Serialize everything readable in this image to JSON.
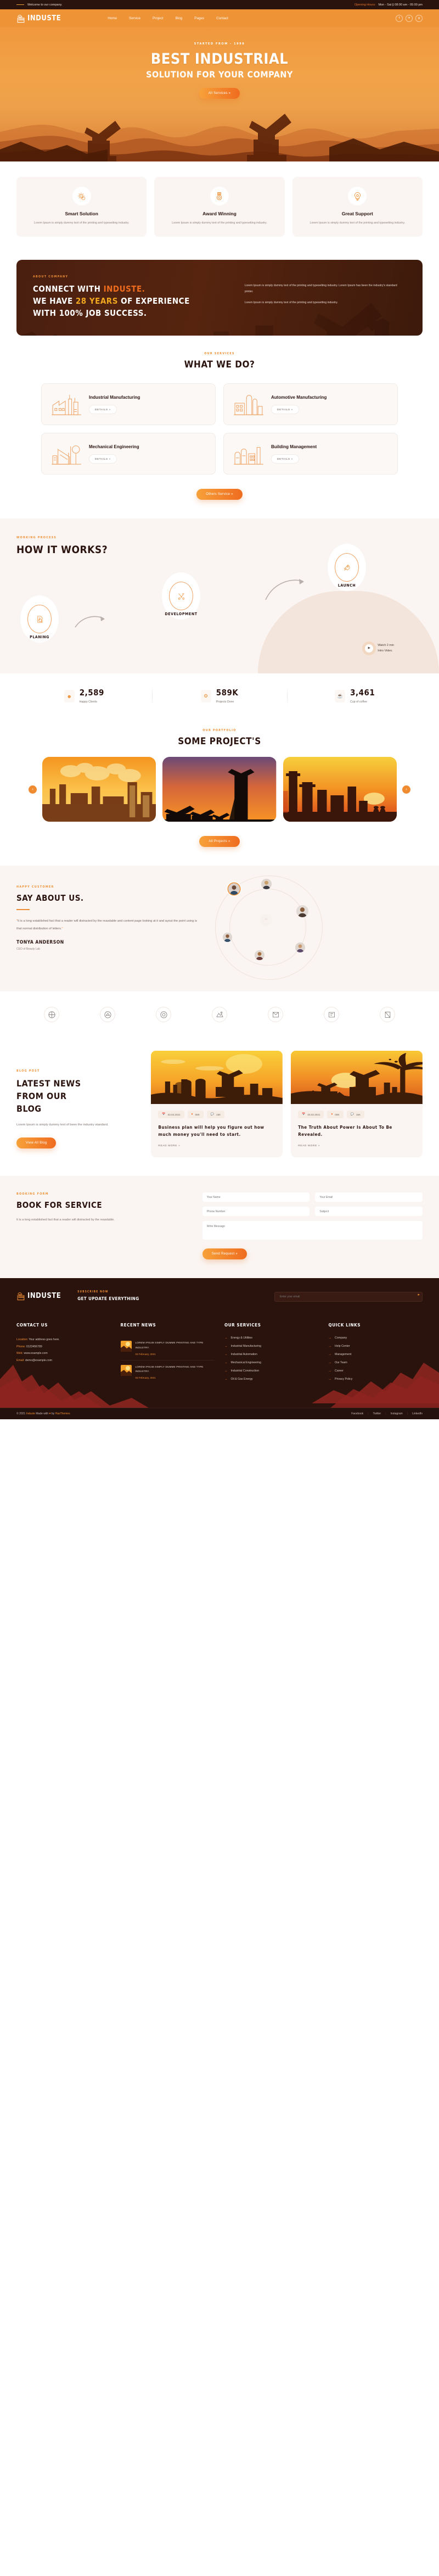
{
  "topbar": {
    "welcome": "Welcome to our company.",
    "opening_label": "Opening Hours:",
    "opening_value": "Mon - Sat || 08:00 am - 05:00 pm"
  },
  "header": {
    "brand": "INDUSTE",
    "nav": [
      {
        "label": "Home"
      },
      {
        "label": "Service"
      },
      {
        "label": "Project"
      },
      {
        "label": "Blog"
      },
      {
        "label": "Pages"
      },
      {
        "label": "Contact"
      }
    ],
    "socials": [
      {
        "name": "facebook-icon",
        "glyph": "f"
      },
      {
        "name": "twitter-icon",
        "glyph": "✈"
      },
      {
        "name": "google-icon",
        "glyph": "g"
      }
    ]
  },
  "hero": {
    "kicker": "STARTED FROM - 1998",
    "title_line1": "BEST INDUSTRIAL",
    "title_line2": "SOLUTION FOR YOUR COMPANY",
    "cta": "All Services »"
  },
  "features": [
    {
      "icon": "gear-icon",
      "title": "Smart Solution",
      "text": "Lorem Ipsum is simply dummy text of the printing and typesetting industry."
    },
    {
      "icon": "medal-icon",
      "title": "Award Winning",
      "text": "Lorem Ipsum is simply dummy text of the printing and typesetting industry."
    },
    {
      "icon": "bulb-icon",
      "title": "Great Support",
      "text": "Lorem Ipsum is simply dummy text of the printing and typesetting industry."
    }
  ],
  "about": {
    "kicker": "ABOUT COMPANY",
    "h_line1_a": "CONNECT WITH ",
    "h_line1_b": "INDUSTE.",
    "h_line2_a": "WE HAVE ",
    "h_line2_b": "28 YEARS",
    "h_line2_c": " OF EXPERIENCE",
    "h_line3": "WITH 100% JOB SUCCESS.",
    "p1": "Lorem Ipsum is simply dummy text of the printing and typesetting industry. Lorem Ipsum has been the industry's standard printer.",
    "p2": "Lorem Ipsum is simply dummy text of the printing and typesetting industry."
  },
  "services": {
    "kicker": "OUR SERVICES",
    "title": "WHAT WE DO?",
    "details_label": "DETAILS »",
    "items": [
      {
        "icon": "factory-icon",
        "title": "Industrial Manufacturing"
      },
      {
        "icon": "silo-icon",
        "title": "Automotive Manufacturing"
      },
      {
        "icon": "plant-icon",
        "title": "Mechanical Engineering"
      },
      {
        "icon": "refinery-icon",
        "title": "Building Management"
      }
    ],
    "cta": "Others Service »"
  },
  "how": {
    "kicker": "WORKING PROCESS",
    "title": "HOW IT WORKS?",
    "steps": [
      {
        "icon": "research-icon",
        "label": "PLANING"
      },
      {
        "icon": "tools-icon",
        "label": "DEVELOPMENT"
      },
      {
        "icon": "rocket-icon",
        "label": "LAUNCH"
      }
    ],
    "watch_line1": "Watch 2 min",
    "watch_line2": "Intro Video."
  },
  "counters": [
    {
      "icon": "user-icon",
      "value": "2,589",
      "label": "Happy Clients"
    },
    {
      "icon": "gear-icon",
      "value": "589K",
      "label": "Projects Done"
    },
    {
      "icon": "coffee-icon",
      "value": "3,461",
      "label": "Cup of coffee"
    }
  ],
  "portfolio": {
    "kicker": "OUR PORTFOLIO",
    "title": "SOME PROJECT'S",
    "prev": "‹",
    "next": "›",
    "cta": "All Projects »",
    "slides": [
      {
        "name": "refinery-sunset"
      },
      {
        "name": "oil-rig-dusk"
      },
      {
        "name": "plant-sunrise"
      }
    ]
  },
  "testimonial": {
    "kicker": "HAPPY CUSTOMER",
    "title": "SAY ABOUT US.",
    "quote": "It is a long established fact that a reader will distracted by the reasdable and content page looking at it and ayout the point using is that normal distribution of letters.",
    "name": "Tonya Anderson",
    "role": "CEO of Beauty Lab"
  },
  "brands": [
    {
      "name": "brand-logo-1"
    },
    {
      "name": "brand-logo-2"
    },
    {
      "name": "brand-logo-3"
    },
    {
      "name": "brand-logo-4"
    },
    {
      "name": "brand-logo-5"
    },
    {
      "name": "brand-logo-6"
    },
    {
      "name": "brand-logo-7"
    }
  ],
  "blog": {
    "kicker": "BLOG POST",
    "title_l1": "LATEST NEWS",
    "title_l2": "FROM OUR",
    "title_l3": "BLOG",
    "text": "Lorem Ipsum is simply dummy text of been the industry standard.",
    "cta": "View All Blog",
    "read_more": "READ MORE »",
    "posts": [
      {
        "date": "03.02.2021",
        "likes": "08K",
        "comments": "15K",
        "title": "Business plan will help you figure out how much money you'll need to start."
      },
      {
        "date": "03.02.2021",
        "likes": "08K",
        "comments": "15K",
        "title": "The Truth About Power Is About To Be Revealed."
      }
    ]
  },
  "booking": {
    "kicker": "BOOKING FORM",
    "title": "BOOK FOR SERVICE",
    "text": "It is a long established fact that a reader will distracted by the reasdable.",
    "fields": {
      "name": "Your Name",
      "email": "Your Email",
      "phone": "Phone Number",
      "subject": "Subject",
      "message": "Write Message"
    },
    "submit": "Send Request »"
  },
  "footer": {
    "brand": "INDUSTE",
    "newsletter_kicker": "SUBSCRIBE NOW",
    "newsletter_title": "GET UPDATE EVERYTHING",
    "newsletter_placeholder": "Enter your email",
    "contact": {
      "heading": "CONTACT US",
      "rows": [
        {
          "label": "Location:",
          "value": "Your address goes here."
        },
        {
          "label": "Phone:",
          "value": "0123456789"
        },
        {
          "label": "Web:",
          "value": "www.example.com"
        },
        {
          "label": "Email:",
          "value": "demo@example.com"
        }
      ]
    },
    "recent": {
      "heading": "RECENT NEWS",
      "items": [
        {
          "title": "LOREM IPSUM SIMPLY DUMME PRINTING AND TYPE INDUSTRY.",
          "date": "03 February, 2021"
        },
        {
          "title": "LOREM IPSUM SIMPLY DUMME PRINTING AND TYPE INDUSTRY.",
          "date": "03 February, 2021"
        }
      ]
    },
    "services": {
      "heading": "OUR SERVICES",
      "items": [
        {
          "label": "Energy & Utilities"
        },
        {
          "label": "Industrial Manufacturing"
        },
        {
          "label": "Industrial Automation"
        },
        {
          "label": "Mechanical Engineering"
        },
        {
          "label": "Industrial Construction"
        },
        {
          "label": "Oil & Gas Energy"
        }
      ]
    },
    "quick": {
      "heading": "QUICK LINKS",
      "items": [
        {
          "label": "Company"
        },
        {
          "label": "Help Center"
        },
        {
          "label": "Management"
        },
        {
          "label": "Our Team"
        },
        {
          "label": "Career"
        },
        {
          "label": "Privacy Policy"
        }
      ]
    },
    "copyright_a": "© 2021 ",
    "copyright_brand": "Induste",
    "copyright_b": " Made with ",
    "copyright_heart": "♥",
    "copyright_c": " by ",
    "copyright_author": "HasThemes",
    "bottom_links": [
      {
        "label": "Facebook"
      },
      {
        "label": "Twitter"
      },
      {
        "label": "Instagram"
      },
      {
        "label": "LinkedIn"
      }
    ]
  },
  "colors": {
    "accent": "#ef8f33",
    "accent_deep": "#ef6c1f",
    "dark": "#2a120d"
  }
}
